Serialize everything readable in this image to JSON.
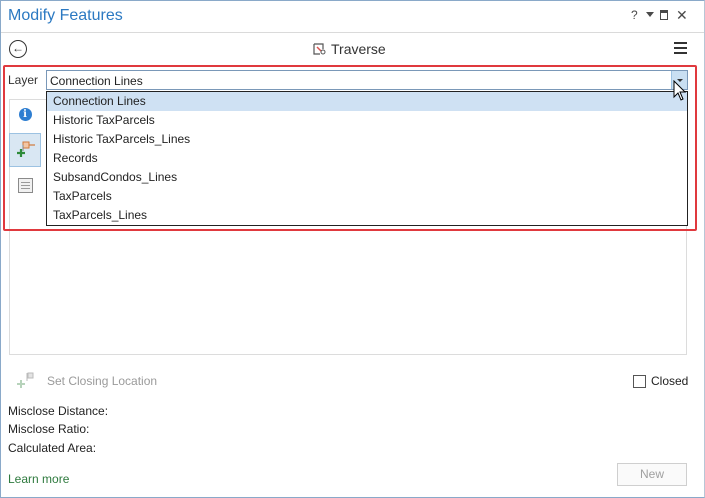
{
  "window": {
    "title": "Modify Features",
    "help_label": "?"
  },
  "tool": {
    "title": "Traverse"
  },
  "layer": {
    "label": "Layer",
    "selected": "Connection Lines",
    "options": [
      "Connection Lines",
      "Historic TaxParcels",
      "Historic TaxParcels_Lines",
      "Records",
      "SubsandCondos_Lines",
      "TaxParcels",
      "TaxParcels_Lines"
    ]
  },
  "closing": {
    "set_closing_location": "Set Closing Location",
    "closed_label": "Closed"
  },
  "stats": {
    "misclose_distance": "Misclose Distance:",
    "misclose_ratio": "Misclose Ratio:",
    "calculated_area": "Calculated Area:"
  },
  "footer": {
    "learn_more": "Learn more",
    "new_button": "New"
  },
  "colors": {
    "title_blue": "#2b79c2",
    "highlight_red": "#e0393e",
    "selected_item": "#cfe1f3",
    "learn_link": "#2e7a3e"
  }
}
